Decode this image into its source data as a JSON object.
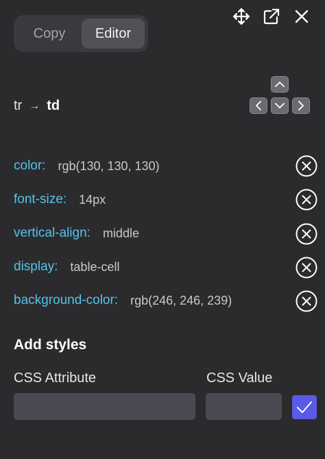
{
  "segment": {
    "copy_label": "Copy",
    "editor_label": "Editor",
    "active": "Editor"
  },
  "window_icons": [
    "move-icon",
    "open-external-icon",
    "close-icon"
  ],
  "breadcrumb": {
    "parent": "tr",
    "separator": "→",
    "current": "td"
  },
  "nav_icons": [
    "chevron-up-icon",
    "chevron-left-icon",
    "chevron-down-icon",
    "chevron-right-icon"
  ],
  "styles": [
    {
      "property": "color:",
      "value": "rgb(130, 130, 130)"
    },
    {
      "property": "font-size:",
      "value": "14px"
    },
    {
      "property": "vertical-align:",
      "value": "middle"
    },
    {
      "property": "display:",
      "value": "table-cell"
    },
    {
      "property": "background-color:",
      "value": "rgb(246, 246, 239)"
    }
  ],
  "add_styles": {
    "heading": "Add styles",
    "attribute_label": "CSS Attribute",
    "value_label": "CSS Value",
    "attribute_value": "",
    "value_value": ""
  },
  "colors": {
    "background": "#2b2b2e",
    "property_key": "#55c3ea",
    "confirm": "#5a5ae8"
  }
}
